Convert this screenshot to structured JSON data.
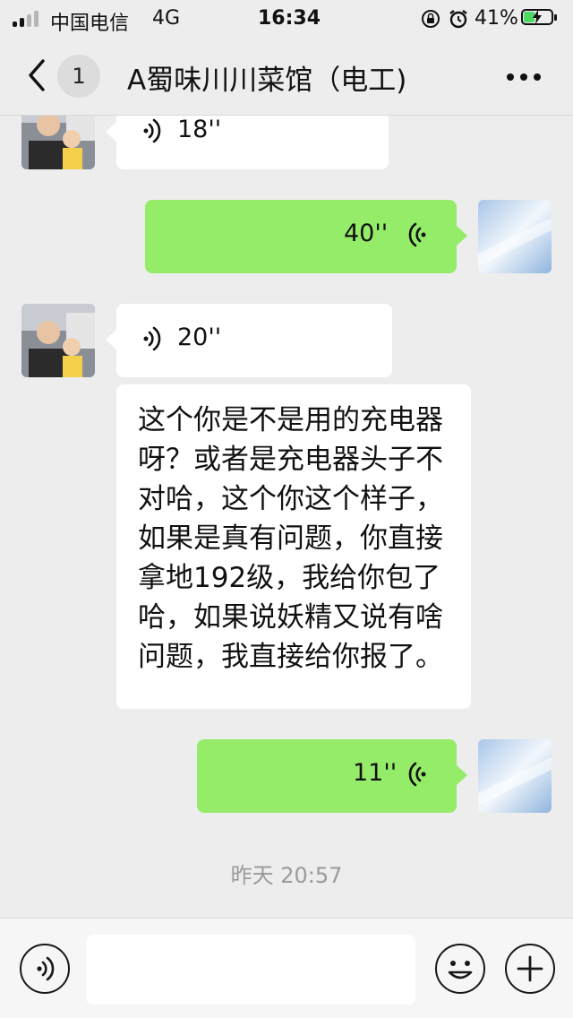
{
  "status_bar": {
    "carrier": "中国电信",
    "network": "4G",
    "time": "16:34",
    "battery_percent": "41%",
    "battery_level": 0.41,
    "charging": true,
    "icons": [
      "signal-icon",
      "rotation-lock-icon",
      "alarm-icon",
      "battery-charging-icon"
    ]
  },
  "nav": {
    "back_icon": "chevron-left-icon",
    "unread_count": "1",
    "title": "A蜀味川川菜馆（电工)",
    "more_icon": "more-dots-icon"
  },
  "messages": [
    {
      "type": "voice",
      "direction": "incoming",
      "duration": "18''"
    },
    {
      "type": "voice",
      "direction": "outgoing",
      "duration": "40''"
    },
    {
      "type": "voice",
      "direction": "incoming",
      "duration": "20''"
    },
    {
      "type": "text",
      "direction": "incoming",
      "text": "这个你是不是用的充电器呀？或者是充电器头子不对哈，这个你这个样子，如果是真有问题，你直接拿地192级，我给你包了哈，如果说妖精又说有啥问题，我直接给你报了。"
    },
    {
      "type": "voice",
      "direction": "outgoing",
      "duration": "11''"
    }
  ],
  "timestamp": "昨天 20:57",
  "input_bar": {
    "voice_icon": "voice-input-icon",
    "emoji_icon": "emoji-icon",
    "plus_icon": "plus-icon",
    "placeholder": ""
  },
  "colors": {
    "background": "#ededed",
    "incoming_bubble": "#ffffff",
    "outgoing_bubble": "#95ec69",
    "timestamp_text": "#9a9a9a",
    "battery_green": "#4cd964"
  }
}
